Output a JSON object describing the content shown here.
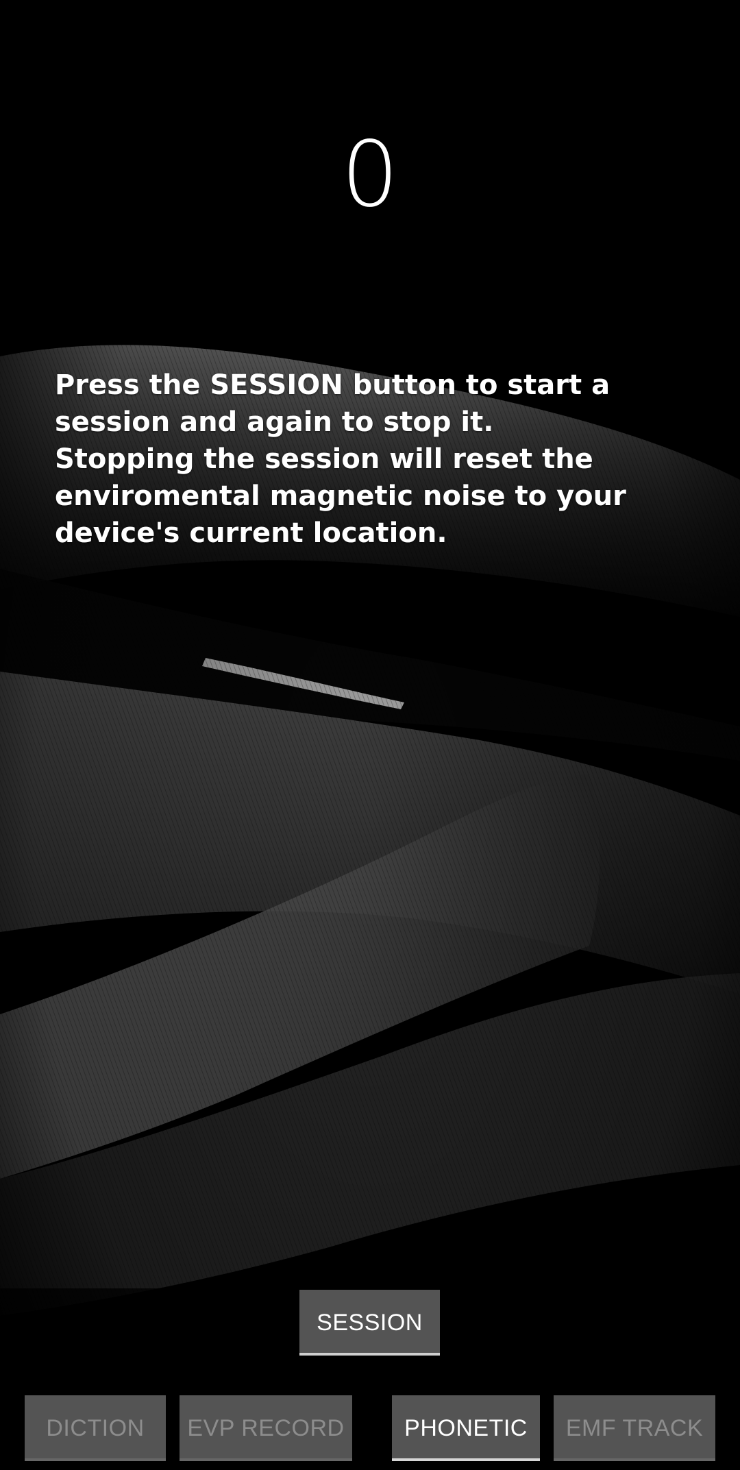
{
  "counter": {
    "value": "0"
  },
  "instructions": {
    "line1": "Press the SESSION button to start a session and again to stop it.",
    "line2": "Stopping the session will reset the enviromental magnetic noise to your device's current location."
  },
  "buttons": {
    "session": "SESSION",
    "diction": "DICTION",
    "evp_record": "EVP RECORD",
    "phonetic": "PHONETIC",
    "emf_track": "EMF TRACK"
  },
  "colors": {
    "background": "#000000",
    "button_bg": "#545454",
    "button_text_active": "#ffffff",
    "button_text_disabled": "#8d8d8d"
  }
}
